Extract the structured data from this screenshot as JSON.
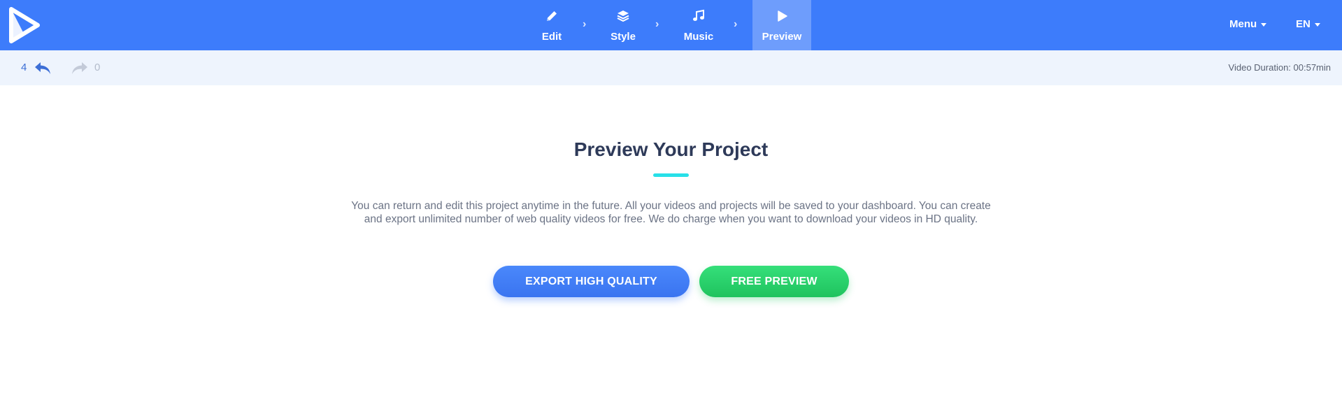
{
  "nav": {
    "steps": [
      {
        "label": "Edit",
        "icon": "pencil-icon"
      },
      {
        "label": "Style",
        "icon": "layers-icon"
      },
      {
        "label": "Music",
        "icon": "music-note-icon"
      },
      {
        "label": "Preview",
        "icon": "play-icon",
        "active": true
      }
    ],
    "menu_label": "Menu",
    "language_label": "EN"
  },
  "history": {
    "undo_count": "4",
    "redo_count": "0"
  },
  "video_duration": "Video Duration: 00:57min",
  "main": {
    "title": "Preview Your Project",
    "description": "You can return and edit this project anytime in the future. All your videos and projects will be saved to your dashboard. You can create and export unlimited number of web quality videos for free. We do charge when you want to download your videos in HD quality.",
    "export_button_label": "EXPORT HIGH QUALITY",
    "preview_button_label": "FREE PREVIEW"
  },
  "colors": {
    "brand_blue": "#3d7cfb",
    "active_step": "#6e9dfc",
    "accent_cyan": "#28e0e8",
    "export_button": "#3d7cfb",
    "preview_button": "#28d06b"
  }
}
